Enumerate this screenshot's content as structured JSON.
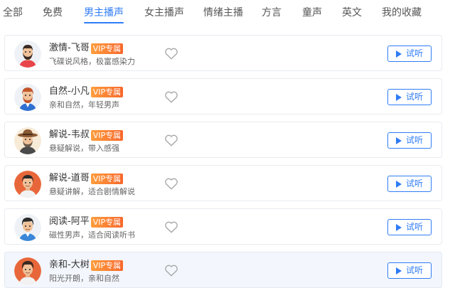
{
  "tabs": [
    {
      "label": "全部"
    },
    {
      "label": "免费"
    },
    {
      "label": "男主播声"
    },
    {
      "label": "女主播声"
    },
    {
      "label": "情绪主播"
    },
    {
      "label": "方言"
    },
    {
      "label": "童声"
    },
    {
      "label": "英文"
    },
    {
      "label": "我的收藏"
    }
  ],
  "active_tab": "男主播声",
  "colors": {
    "accent": "#2f7cf6",
    "vip_badge": "#f7682c",
    "selected_row": "#f3f6fc"
  },
  "voices": [
    {
      "name": "激情-飞哥",
      "badge": "VIP专属",
      "desc": "飞碟说风格，极富感染力",
      "listen_label": "试听",
      "avatar": "bearded-man-red-shirt"
    },
    {
      "name": "自然-小凡",
      "badge": "VIP专属",
      "desc": "亲和自然，年轻男声",
      "listen_label": "试听",
      "avatar": "red-haired-bearded-man"
    },
    {
      "name": "解说-韦叔",
      "badge": "VIP专属",
      "desc": "悬疑解说，带入感强",
      "listen_label": "试听",
      "avatar": "man-with-hat-and-beard"
    },
    {
      "name": "解说-道哥",
      "badge": "VIP专属",
      "desc": "悬疑讲解，适合剧情解说",
      "listen_label": "试听",
      "avatar": "man-on-orange-background"
    },
    {
      "name": "阅读-阿平",
      "badge": "VIP专属",
      "desc": "磁性男声，适合阅读听书",
      "listen_label": "试听",
      "avatar": "young-man-blue-shirt"
    },
    {
      "name": "亲和-大树",
      "badge": "VIP专属",
      "desc": "阳光开朗，亲和自然",
      "listen_label": "试听",
      "avatar": "boy-on-orange-background"
    }
  ],
  "selected_index": 5
}
